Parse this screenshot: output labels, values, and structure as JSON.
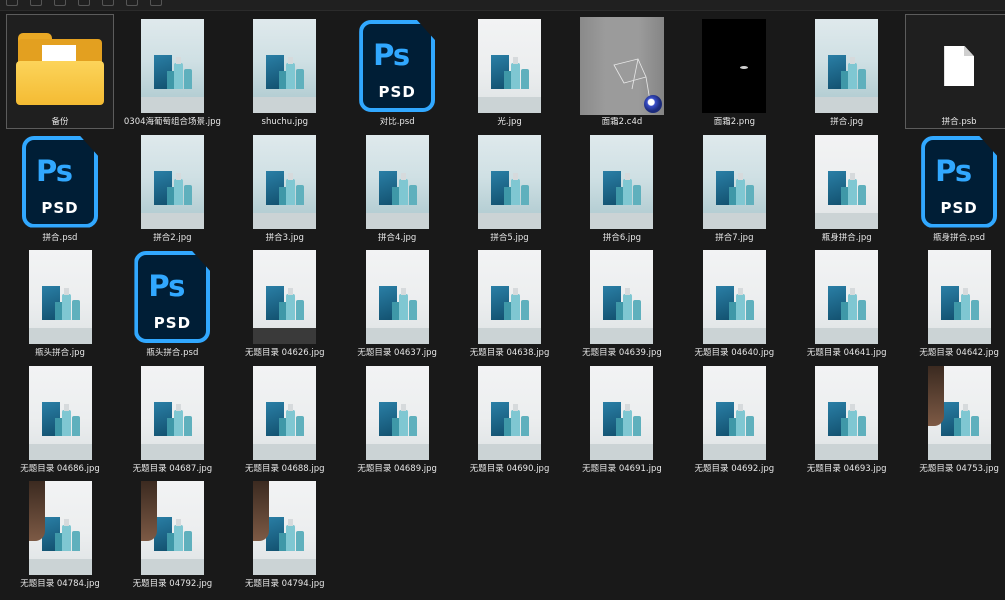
{
  "colors": {
    "background": "#191919",
    "label_text": "#e6e6e6",
    "ps_blue": "#31a8ff",
    "ps_dark": "#001e36",
    "folder_yellow": "#f4bb33"
  },
  "files": [
    {
      "name": "备份",
      "kind": "folder",
      "icon": "folder-icon",
      "selected": true
    },
    {
      "name": "0304海葡萄组合场景.jpg",
      "kind": "photo",
      "icon": "image-thumbnail"
    },
    {
      "name": "shuchu.jpg",
      "kind": "photo",
      "icon": "image-thumbnail"
    },
    {
      "name": "对比.psd",
      "kind": "psd",
      "icon": "photoshop-file-icon"
    },
    {
      "name": "光.jpg",
      "kind": "photo-white",
      "icon": "image-thumbnail"
    },
    {
      "name": "面霜2.c4d",
      "kind": "c4d",
      "icon": "cinema4d-file-icon"
    },
    {
      "name": "面霜2.png",
      "kind": "black",
      "icon": "image-thumbnail"
    },
    {
      "name": "拼合.jpg",
      "kind": "photo",
      "icon": "image-thumbnail"
    },
    {
      "name": "拼合.psb",
      "kind": "doc",
      "icon": "blank-document-icon",
      "selected": true
    },
    {
      "name": "拼合.psd",
      "kind": "psd",
      "icon": "photoshop-file-icon"
    },
    {
      "name": "拼合2.jpg",
      "kind": "photo",
      "icon": "image-thumbnail"
    },
    {
      "name": "拼合3.jpg",
      "kind": "photo",
      "icon": "image-thumbnail"
    },
    {
      "name": "拼合4.jpg",
      "kind": "photo",
      "icon": "image-thumbnail"
    },
    {
      "name": "拼合5.jpg",
      "kind": "photo",
      "icon": "image-thumbnail"
    },
    {
      "name": "拼合6.jpg",
      "kind": "photo",
      "icon": "image-thumbnail"
    },
    {
      "name": "拼合7.jpg",
      "kind": "photo",
      "icon": "image-thumbnail"
    },
    {
      "name": "瓶身拼合.jpg",
      "kind": "photo-white",
      "icon": "image-thumbnail"
    },
    {
      "name": "瓶身拼合.psd",
      "kind": "psd",
      "icon": "photoshop-file-icon"
    },
    {
      "name": "瓶头拼合.jpg",
      "kind": "photo-white",
      "icon": "image-thumbnail"
    },
    {
      "name": "瓶头拼合.psd",
      "kind": "psd",
      "icon": "photoshop-file-icon"
    },
    {
      "name": "无题目录 04626.jpg",
      "kind": "photo-white-dark",
      "icon": "image-thumbnail"
    },
    {
      "name": "无题目录 04637.jpg",
      "kind": "photo-white",
      "icon": "image-thumbnail"
    },
    {
      "name": "无题目录 04638.jpg",
      "kind": "photo-white",
      "icon": "image-thumbnail"
    },
    {
      "name": "无题目录 04639.jpg",
      "kind": "photo-white",
      "icon": "image-thumbnail"
    },
    {
      "name": "无题目录 04640.jpg",
      "kind": "photo-white",
      "icon": "image-thumbnail"
    },
    {
      "name": "无题目录 04641.jpg",
      "kind": "photo-white",
      "icon": "image-thumbnail"
    },
    {
      "name": "无题目录 04642.jpg",
      "kind": "photo-white",
      "icon": "image-thumbnail"
    },
    {
      "name": "无题目录 04686.jpg",
      "kind": "photo-white",
      "icon": "image-thumbnail"
    },
    {
      "name": "无题目录 04687.jpg",
      "kind": "photo-white",
      "icon": "image-thumbnail"
    },
    {
      "name": "无题目录 04688.jpg",
      "kind": "photo-white",
      "icon": "image-thumbnail"
    },
    {
      "name": "无题目录 04689.jpg",
      "kind": "photo-white",
      "icon": "image-thumbnail"
    },
    {
      "name": "无题目录 04690.jpg",
      "kind": "photo-white",
      "icon": "image-thumbnail"
    },
    {
      "name": "无题目录 04691.jpg",
      "kind": "photo-white",
      "icon": "image-thumbnail"
    },
    {
      "name": "无题目录 04692.jpg",
      "kind": "photo-white",
      "icon": "image-thumbnail"
    },
    {
      "name": "无题目录 04693.jpg",
      "kind": "photo-white",
      "icon": "image-thumbnail"
    },
    {
      "name": "无题目录 04753.jpg",
      "kind": "photo-hand",
      "icon": "image-thumbnail"
    },
    {
      "name": "无题目录 04784.jpg",
      "kind": "photo-hand",
      "icon": "image-thumbnail"
    },
    {
      "name": "无题目录 04792.jpg",
      "kind": "photo-hand",
      "icon": "image-thumbnail"
    },
    {
      "name": "无题目录 04794.jpg",
      "kind": "photo-hand",
      "icon": "image-thumbnail"
    }
  ],
  "psd_icon": {
    "logo_text": "Ps",
    "format_text": "PSD"
  }
}
